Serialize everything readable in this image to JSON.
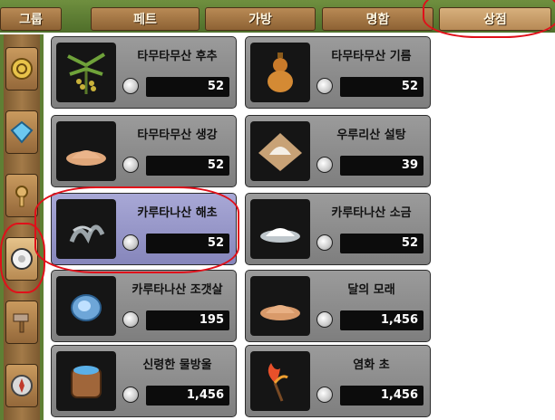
{
  "tabs": [
    {
      "label": "그룹"
    },
    {
      "label": "페트"
    },
    {
      "label": "가방"
    },
    {
      "label": "명함"
    },
    {
      "label": "상점",
      "active": true
    }
  ],
  "sidebar": {
    "items": [
      {
        "icon": "coin-ring-icon"
      },
      {
        "icon": "diamond-icon"
      },
      {
        "icon": "gear-tool-icon"
      },
      {
        "icon": "white-coin-icon",
        "active": true
      },
      {
        "icon": "hammer-icon"
      },
      {
        "icon": "compass-icon"
      }
    ]
  },
  "items": [
    {
      "name": "타무타무산 후추",
      "price": "52",
      "icon": "pepper-plant-icon"
    },
    {
      "name": "타무타무산 기름",
      "price": "52",
      "icon": "oil-gourd-icon"
    },
    {
      "name": "타무타무산 생강",
      "price": "52",
      "icon": "ginger-powder-icon"
    },
    {
      "name": "우루리산 설탕",
      "price": "39",
      "icon": "sugar-pile-icon"
    },
    {
      "name": "카루타나산 해초",
      "price": "52",
      "icon": "seaweed-icon",
      "selected": true
    },
    {
      "name": "카루타나산 소금",
      "price": "52",
      "icon": "salt-pile-icon"
    },
    {
      "name": "카루타나산 조갯살",
      "price": "195",
      "icon": "clam-meat-icon"
    },
    {
      "name": "달의 모래",
      "price": "1,456",
      "icon": "moon-sand-icon"
    },
    {
      "name": "신령한 물방울",
      "price": "1,456",
      "icon": "water-barrel-icon"
    },
    {
      "name": "염화 초",
      "price": "1,456",
      "icon": "flame-herb-icon"
    }
  ],
  "colors": {
    "annotation": "#e0101a",
    "card": "#8a8a8a",
    "card_selected": "#9a9ad0"
  }
}
